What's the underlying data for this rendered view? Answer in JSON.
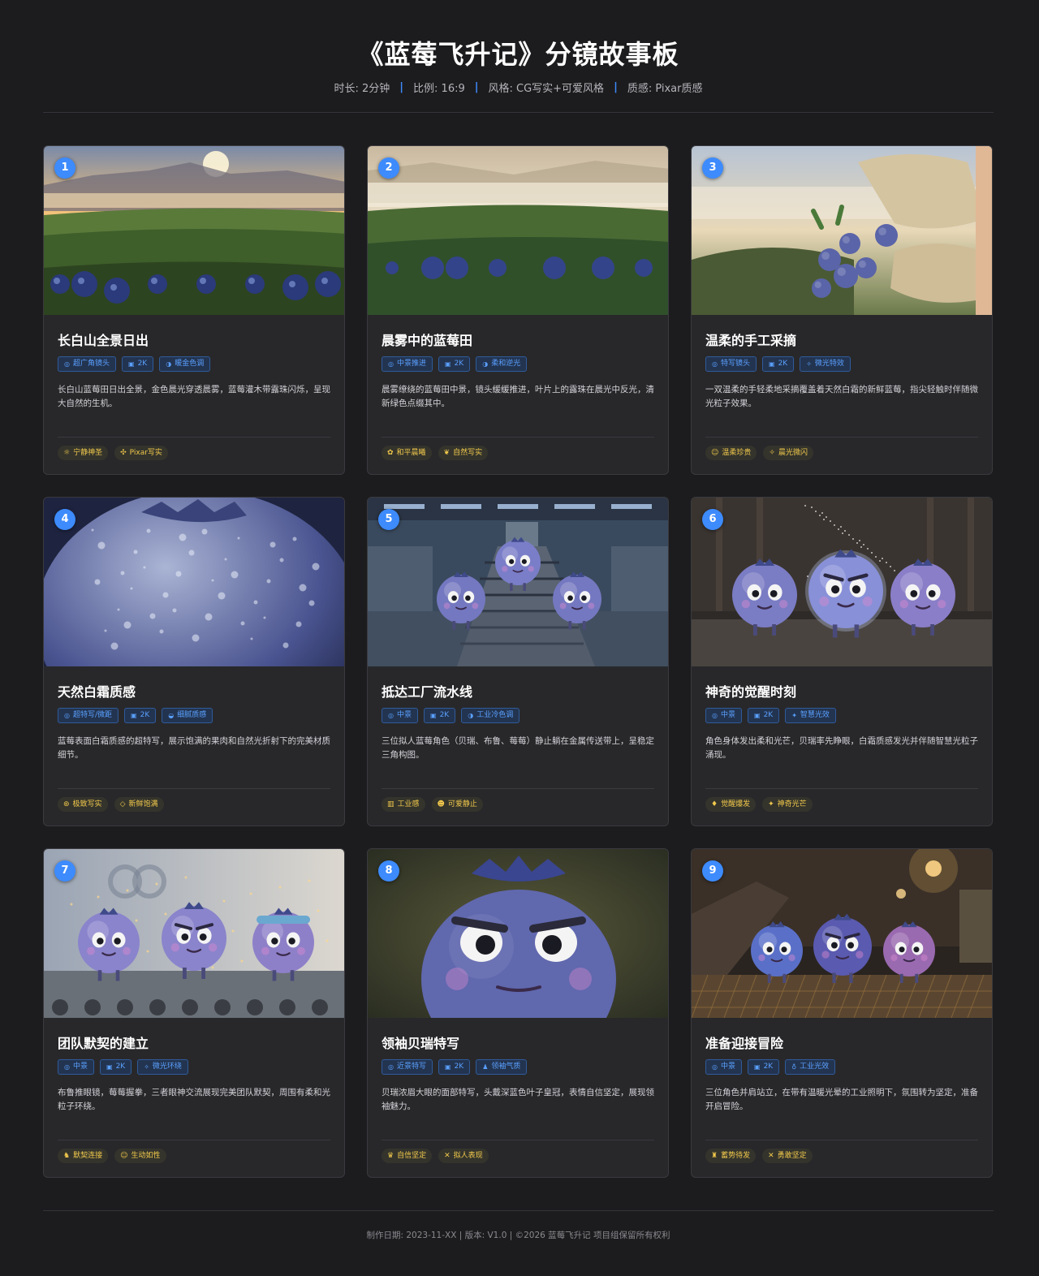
{
  "header": {
    "title": "《蓝莓飞升记》分镜故事板",
    "meta": [
      {
        "label": "时长: 2分钟"
      },
      {
        "label": "比例: 16:9"
      },
      {
        "label": "风格: CG写实+可爱风格"
      },
      {
        "label": "质感: Pixar质感"
      }
    ]
  },
  "colors": {
    "background": "#1c1c1e",
    "card": "#28282b",
    "accent": "#3d8bfd",
    "tag_text": "#5aa0ff",
    "mood_text": "#f2c94c"
  },
  "scenes": [
    {
      "num": "1",
      "title": "长白山全景日出",
      "tags": [
        {
          "icon": "◎",
          "label": "超广角镜头"
        },
        {
          "icon": "▣",
          "label": "2K"
        },
        {
          "icon": "◑",
          "label": "暖金色调"
        }
      ],
      "desc": "长白山蓝莓田日出全景，金色晨光穿透晨雾，蓝莓灌木带露珠闪烁，呈现大自然的生机。",
      "moods": [
        {
          "icon": "☼",
          "label": "宁静神圣"
        },
        {
          "icon": "✣",
          "label": "Pixar写实"
        }
      ],
      "image": "sunrise-landscape"
    },
    {
      "num": "2",
      "title": "晨雾中的蓝莓田",
      "tags": [
        {
          "icon": "◎",
          "label": "中景推进"
        },
        {
          "icon": "▣",
          "label": "2K"
        },
        {
          "icon": "◑",
          "label": "柔和逆光"
        }
      ],
      "desc": "晨雾缭绕的蓝莓田中景，镜头缓缓推进，叶片上的露珠在晨光中反光，清新绿色点缀其中。",
      "moods": [
        {
          "icon": "✿",
          "label": "和平晨曦"
        },
        {
          "icon": "❦",
          "label": "自然写实"
        }
      ],
      "image": "misty-field"
    },
    {
      "num": "3",
      "title": "温柔的手工采摘",
      "tags": [
        {
          "icon": "◎",
          "label": "特写镜头"
        },
        {
          "icon": "▣",
          "label": "2K"
        },
        {
          "icon": "✧",
          "label": "微光特效"
        }
      ],
      "desc": "一双温柔的手轻柔地采摘覆盖着天然白霜的新鲜蓝莓，指尖轻触时伴随微光粒子效果。",
      "moods": [
        {
          "icon": "☺",
          "label": "温柔珍贵"
        },
        {
          "icon": "✧",
          "label": "晨光微闪"
        }
      ],
      "image": "gloved-hands"
    },
    {
      "num": "4",
      "title": "天然白霜质感",
      "tags": [
        {
          "icon": "◎",
          "label": "超特写/微距"
        },
        {
          "icon": "▣",
          "label": "2K"
        },
        {
          "icon": "◒",
          "label": "细腻质感"
        }
      ],
      "desc": "蓝莓表面白霜质感的超特写，展示饱满的果肉和自然光折射下的完美材质细节。",
      "moods": [
        {
          "icon": "⊛",
          "label": "极致写实"
        },
        {
          "icon": "◇",
          "label": "新鲜饱满"
        }
      ],
      "image": "macro-berry"
    },
    {
      "num": "5",
      "title": "抵达工厂流水线",
      "tags": [
        {
          "icon": "◎",
          "label": "中景"
        },
        {
          "icon": "▣",
          "label": "2K"
        },
        {
          "icon": "◑",
          "label": "工业冷色调"
        }
      ],
      "desc": "三位拟人蓝莓角色（贝瑞、布鲁、莓莓）静止躺在金属传送带上，呈稳定三角构图。",
      "moods": [
        {
          "icon": "▥",
          "label": "工业感"
        },
        {
          "icon": "☻",
          "label": "可爱静止"
        }
      ],
      "image": "factory-conveyor"
    },
    {
      "num": "6",
      "title": "神奇的觉醒时刻",
      "tags": [
        {
          "icon": "◎",
          "label": "中景"
        },
        {
          "icon": "▣",
          "label": "2K"
        },
        {
          "icon": "✦",
          "label": "智慧光效"
        }
      ],
      "desc": "角色身体发出柔和光芒，贝瑞率先睁眼，白霜质感发光并伴随智慧光粒子涌现。",
      "moods": [
        {
          "icon": "♦",
          "label": "觉醒爆发"
        },
        {
          "icon": "✦",
          "label": "神奇光芒"
        }
      ],
      "image": "awakening-trio"
    },
    {
      "num": "7",
      "title": "团队默契的建立",
      "tags": [
        {
          "icon": "◎",
          "label": "中景"
        },
        {
          "icon": "▣",
          "label": "2K"
        },
        {
          "icon": "✧",
          "label": "微光环绕"
        }
      ],
      "desc": "布鲁推眼镜，莓莓握拳，三者眼神交流展现完美团队默契，周围有柔和光粒子环绕。",
      "moods": [
        {
          "icon": "♞",
          "label": "默契连接"
        },
        {
          "icon": "☺",
          "label": "生动如性"
        }
      ],
      "image": "team-trio"
    },
    {
      "num": "8",
      "title": "领袖贝瑞特写",
      "tags": [
        {
          "icon": "◎",
          "label": "近景特写"
        },
        {
          "icon": "▣",
          "label": "2K"
        },
        {
          "icon": "♟",
          "label": "领袖气质"
        }
      ],
      "desc": "贝瑞浓眉大眼的面部特写，头戴深蓝色叶子皇冠，表情自信坚定，展现领袖魅力。",
      "moods": [
        {
          "icon": "♛",
          "label": "自信坚定"
        },
        {
          "icon": "✕",
          "label": "拟人表现"
        }
      ],
      "image": "leader-closeup"
    },
    {
      "num": "9",
      "title": "准备迎接冒险",
      "tags": [
        {
          "icon": "◎",
          "label": "中景"
        },
        {
          "icon": "▣",
          "label": "2K"
        },
        {
          "icon": "♁",
          "label": "工业光效"
        }
      ],
      "desc": "三位角色并肩站立，在带有温暖光晕的工业照明下，氛围转为坚定，准备开启冒险。",
      "moods": [
        {
          "icon": "♜",
          "label": "蓄势待发"
        },
        {
          "icon": "✕",
          "label": "勇敢坚定"
        }
      ],
      "image": "ready-adventure"
    }
  ],
  "footer": {
    "text": "制作日期: 2023-11-XX | 版本: V1.0 | ©2026 蓝莓飞升记 项目组保留所有权利"
  }
}
